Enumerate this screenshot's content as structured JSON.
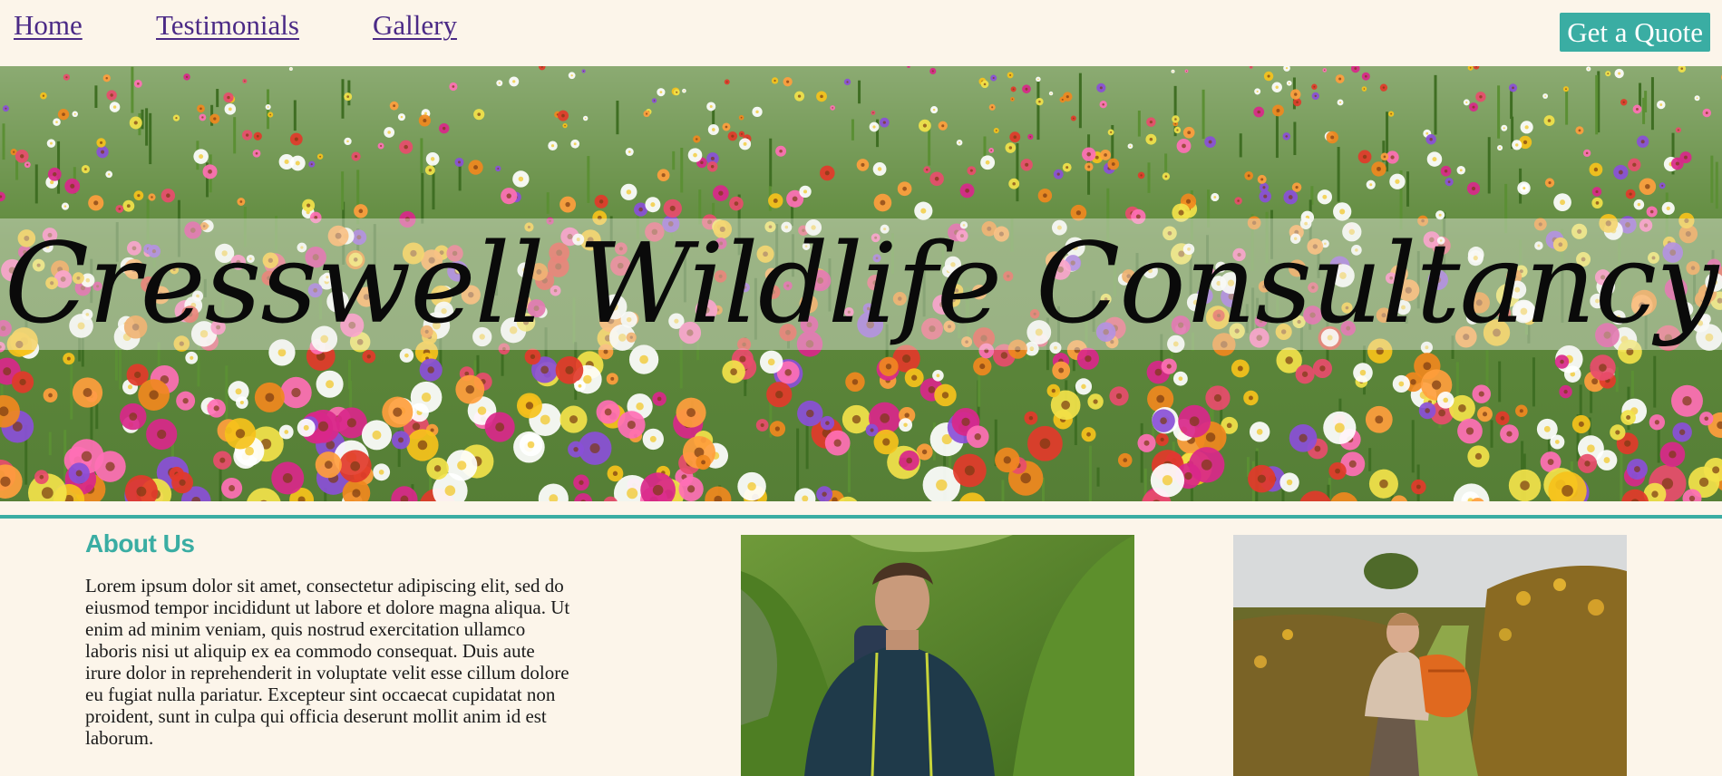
{
  "nav": {
    "links": [
      "Home",
      "Testimonials",
      "Gallery"
    ],
    "quote_button": "Get a Quote"
  },
  "hero": {
    "title": "Cresswell Wildlife Consultancy"
  },
  "about": {
    "heading": "About Us",
    "body": "Lorem ipsum dolor sit amet, consectetur adipiscing elit, sed do eiusmod tempor incididunt ut labore et dolore magna aliqua. Ut enim ad minim veniam, quis nostrud exercitation ullamco laboris nisi ut aliquip ex ea commodo consequat. Duis aute irure dolor in reprehenderit in voluptate velit esse cillum dolore eu fugiat nulla pariatur. Excepteur sint occaecat cupidatat non proident, sunt in culpa qui officia deserunt mollit anim id est laborum."
  },
  "colors": {
    "accent": "#3aada3",
    "background": "#fcf5ea",
    "link": "#4b2a86"
  }
}
